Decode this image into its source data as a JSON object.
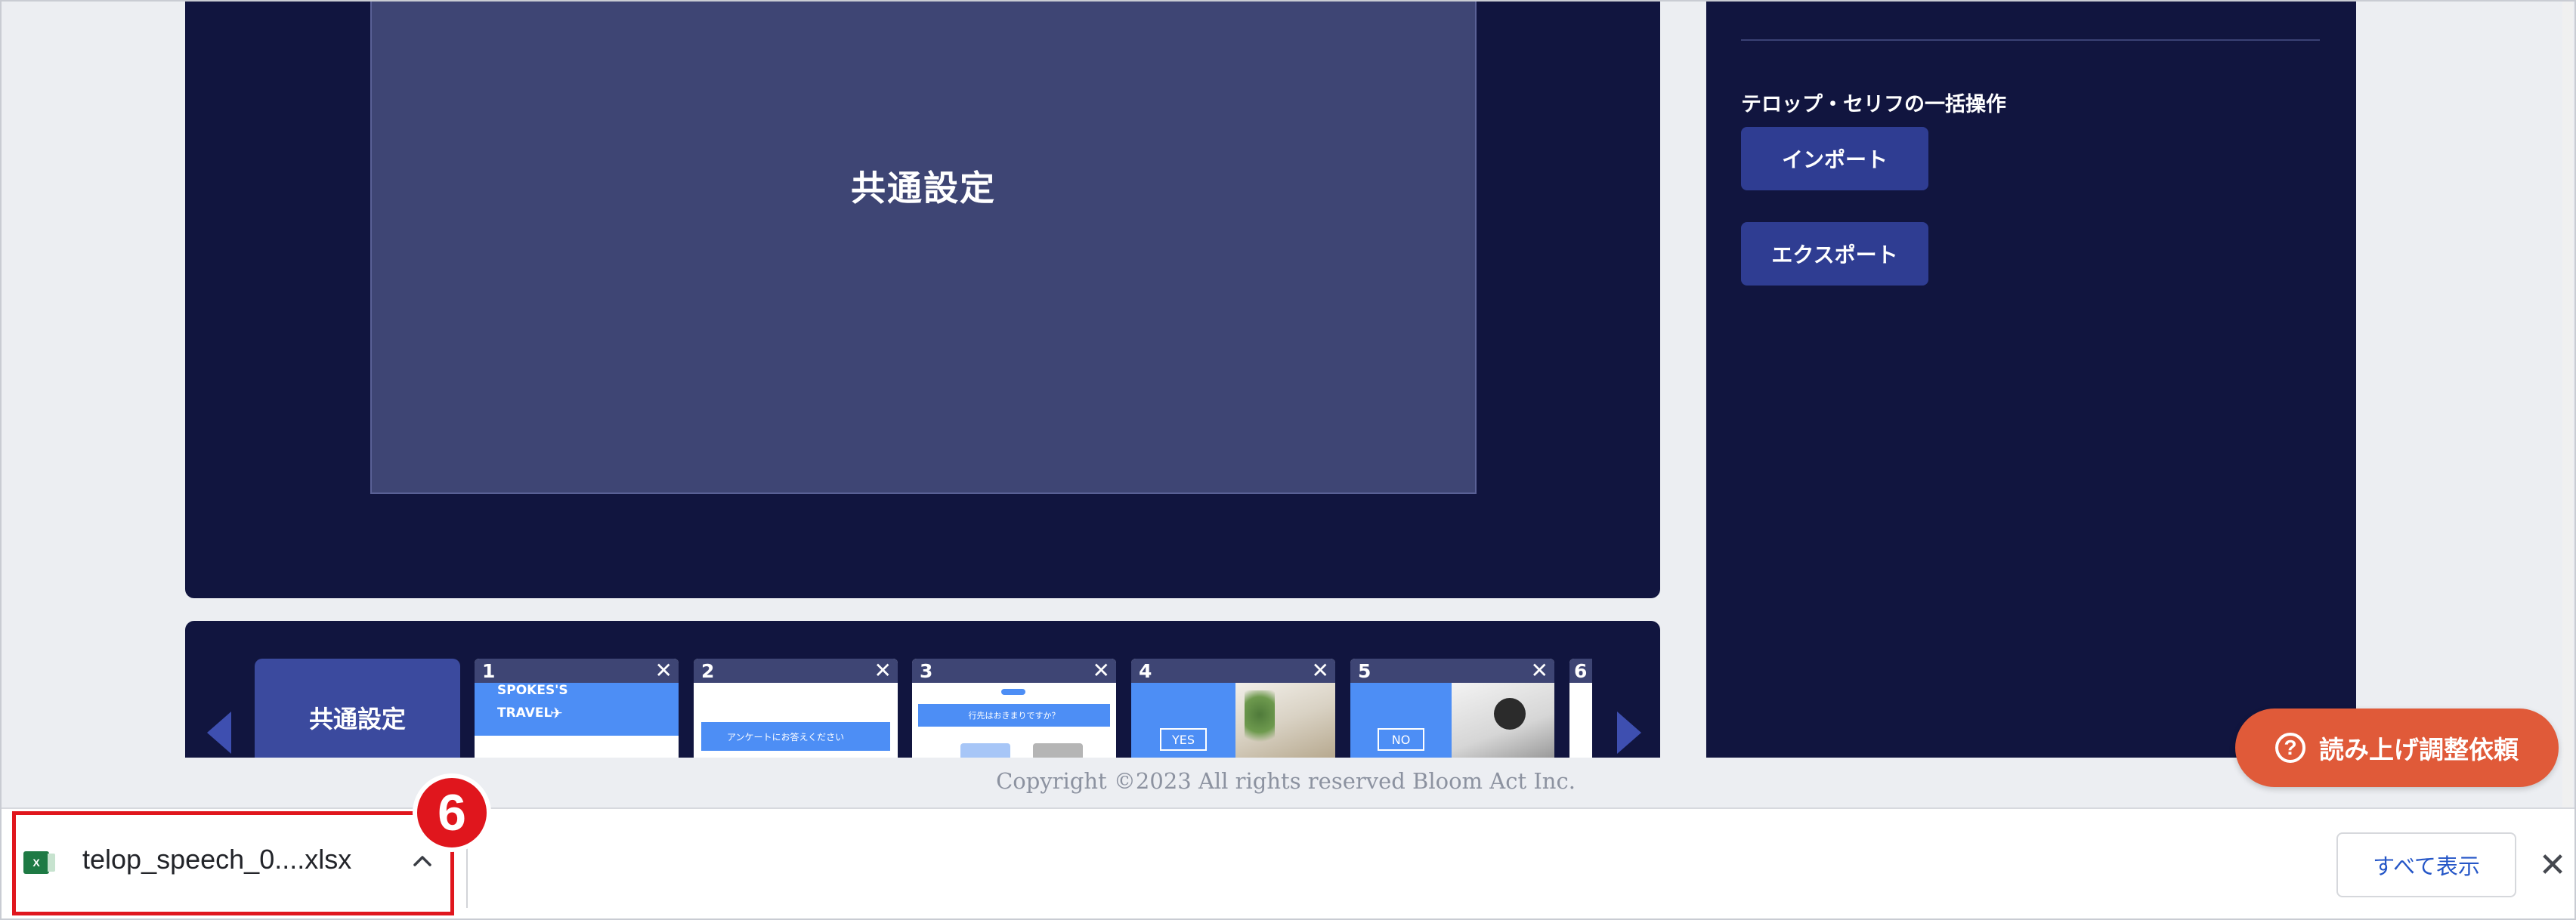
{
  "preview": {
    "title": "共通設定"
  },
  "side": {
    "bulk_label": "テロップ・セリフの一括操作",
    "import_label": "インポート",
    "export_label": "エクスポート"
  },
  "strip": {
    "common_tab": "共通設定",
    "slides": [
      {
        "num": "1",
        "thumb_text_1": "SPOKES'S",
        "thumb_text_2": "TRAVEL"
      },
      {
        "num": "2",
        "thumb_text": "アンケートにお答えください"
      },
      {
        "num": "3",
        "thumb_text": "行先はおきまりですか？"
      },
      {
        "num": "4",
        "thumb_text": "YES"
      },
      {
        "num": "5",
        "thumb_text": "NO"
      },
      {
        "num": "6"
      }
    ],
    "close_glyph": "✕"
  },
  "help": {
    "label": "読み上げ調整依頼",
    "icon_glyph": "?"
  },
  "footer": {
    "copyright": "Copyright ©2023 All rights reserved Bloom Act Inc."
  },
  "download": {
    "file_name": "telop_speech_0....xlsx",
    "icon_text": "X",
    "show_all": "すべて表示",
    "close_glyph": "✕",
    "badge": "6"
  }
}
